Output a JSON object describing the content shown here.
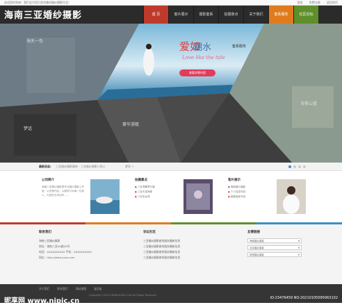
{
  "topbar": {
    "welcome": "欢迎您的到来！我们会为您打造完美的婚纱摄影作品！",
    "links": [
      "登录",
      "免费注册",
      "返回首页"
    ]
  },
  "header": {
    "logo": "海南三亚婚纱摄影"
  },
  "nav": [
    "首 页",
    "客片展示",
    "摄影套系",
    "拍摄景点",
    "关于我们",
    "套系服务",
    "社区论坛"
  ],
  "hero": {
    "title_red": "爱如",
    "title_blue": "潮水",
    "subtitle": "套系服务",
    "script": "Love like the tide",
    "button": "查看详细内容",
    "captions": [
      "海天一色",
      "梦话",
      "豪华游艇",
      "海誓山盟"
    ]
  },
  "news": {
    "label": "最新动态:",
    "items": "三亚婚纱摄影最新 · 三亚婚纱摄影小贴士",
    "more": "更多 >"
  },
  "cards": [
    {
      "title": "公司简介",
      "body": "海南三亚婚纱摄影是专业婚纱摄影工作室，以完美作品，以服务打动每一位新人，为您的艺术创作……"
    },
    {
      "title": "拍摄景点",
      "items": [
        "三亚湾椰梦长廊",
        "三亚天涯海角",
        "三亚亚龙湾"
      ]
    },
    {
      "title": "客片展示",
      "items": [
        "海南婚纱摄影",
        "个人性感写真",
        "闺蜜姐妹写真"
      ]
    }
  ],
  "footer": {
    "contact": {
      "title": "联系我们",
      "lines": [
        "海南三亚婚纱摄影",
        "地址：海南三亚XX路XX号",
        "电话：XXXXXXXXXX  手机：XXXXXXXXXX",
        "网址：http://www.xxxx.com"
      ]
    },
    "community": {
      "title": "论坛社区",
      "lines": [
        "三亚婚纱摄影套系服务最新信息",
        "三亚婚纱摄影套系服务最新信息",
        "三亚婚纱摄影套系服务最新信息",
        "三亚婚纱摄影套系服务最新信息"
      ]
    },
    "links": {
      "title": "友情链接",
      "options": [
        "海南婚纱摄影",
        "北京婚纱摄影",
        "其他婚纱摄影"
      ]
    }
  },
  "bottom": {
    "links": [
      "关于我们",
      "联系我们",
      "网站地图",
      "留言板"
    ],
    "copyright": "Copyright ©2013 WWW.XXXX.COM All Rights Reserved",
    "watermark_left": "昵享网 www.nipic.cn",
    "watermark_right": "ID:23476459 NO:20210105095963102"
  },
  "colors": {
    "accent": "#c03a2b",
    "orange": "#e07b1d",
    "green": "#5f8f2b",
    "blue": "#3a8fc9",
    "dark": "#2b2b2b"
  }
}
